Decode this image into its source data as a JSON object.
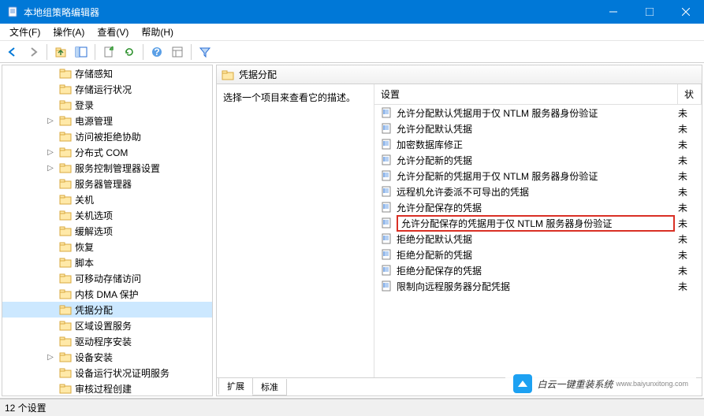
{
  "window": {
    "title": "本地组策略编辑器"
  },
  "menu": {
    "file": "文件(F)",
    "action": "操作(A)",
    "view": "查看(V)",
    "help": "帮助(H)"
  },
  "tree": {
    "items": [
      {
        "label": "存储感知",
        "indent": 3,
        "expander": ""
      },
      {
        "label": "存储运行状况",
        "indent": 3,
        "expander": ""
      },
      {
        "label": "登录",
        "indent": 3,
        "expander": ""
      },
      {
        "label": "电源管理",
        "indent": 3,
        "expander": "▷"
      },
      {
        "label": "访问被拒绝协助",
        "indent": 3,
        "expander": ""
      },
      {
        "label": "分布式 COM",
        "indent": 3,
        "expander": "▷"
      },
      {
        "label": "服务控制管理器设置",
        "indent": 3,
        "expander": "▷"
      },
      {
        "label": "服务器管理器",
        "indent": 3,
        "expander": ""
      },
      {
        "label": "关机",
        "indent": 3,
        "expander": ""
      },
      {
        "label": "关机选项",
        "indent": 3,
        "expander": ""
      },
      {
        "label": "缓解选项",
        "indent": 3,
        "expander": ""
      },
      {
        "label": "恢复",
        "indent": 3,
        "expander": ""
      },
      {
        "label": "脚本",
        "indent": 3,
        "expander": ""
      },
      {
        "label": "可移动存储访问",
        "indent": 3,
        "expander": ""
      },
      {
        "label": "内核 DMA 保护",
        "indent": 3,
        "expander": ""
      },
      {
        "label": "凭据分配",
        "indent": 3,
        "expander": "",
        "selected": true
      },
      {
        "label": "区域设置服务",
        "indent": 3,
        "expander": ""
      },
      {
        "label": "驱动程序安装",
        "indent": 3,
        "expander": ""
      },
      {
        "label": "设备安装",
        "indent": 3,
        "expander": "▷"
      },
      {
        "label": "设备运行状况证明服务",
        "indent": 3,
        "expander": ""
      },
      {
        "label": "审核过程创建",
        "indent": 3,
        "expander": ""
      }
    ]
  },
  "right": {
    "header": "凭据分配",
    "desc": "选择一个项目来查看它的描述。",
    "columns": {
      "c1": "设置",
      "c2": "状"
    },
    "rows": [
      {
        "label": "允许分配默认凭据用于仅 NTLM 服务器身份验证",
        "state": "未"
      },
      {
        "label": "允许分配默认凭据",
        "state": "未"
      },
      {
        "label": "加密数据库修正",
        "state": "未"
      },
      {
        "label": "允许分配新的凭据",
        "state": "未"
      },
      {
        "label": "允许分配新的凭据用于仅 NTLM 服务器身份验证",
        "state": "未"
      },
      {
        "label": "远程机允许委派不可导出的凭据",
        "state": "未"
      },
      {
        "label": "允许分配保存的凭据",
        "state": "未"
      },
      {
        "label": "允许分配保存的凭据用于仅 NTLM 服务器身份验证",
        "state": "未",
        "highlighted": true
      },
      {
        "label": "拒绝分配默认凭据",
        "state": "未"
      },
      {
        "label": "拒绝分配新的凭据",
        "state": "未"
      },
      {
        "label": "拒绝分配保存的凭据",
        "state": "未"
      },
      {
        "label": "限制向远程服务器分配凭据",
        "state": "未"
      }
    ],
    "tabs": {
      "extended": "扩展",
      "standard": "标准"
    }
  },
  "status": "12 个设置",
  "watermark": {
    "text": "白云一键重装系统",
    "url": "www.baiyunxitong.com"
  }
}
